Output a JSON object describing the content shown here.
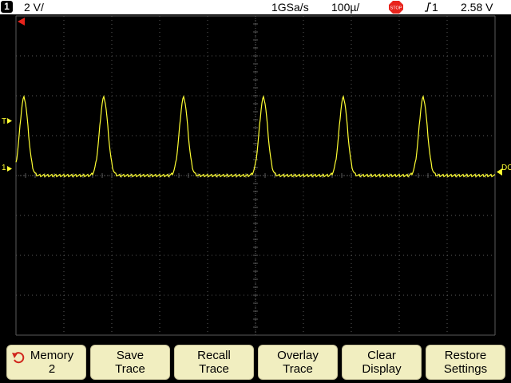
{
  "status_bar": {
    "channel_number": "1",
    "volts_per_div": "2 V/",
    "sample_rate": "1GSa/s",
    "time_per_div": "100µ/",
    "run_state_icon": "stop-icon",
    "run_state_label": "STOP",
    "trigger_slope_icon": "rising-edge-icon",
    "trigger_source": "1",
    "trigger_level": "2.58  V"
  },
  "markers": {
    "trigger_level_marker": "T",
    "channel_ground_marker": "1",
    "coupling_label": "DC"
  },
  "waveform": {
    "color": "#ffff33",
    "channel": "1",
    "peak_count": 6,
    "baseline_div_from_center": 0,
    "peak_div_from_center": 1.95
  },
  "softkeys": [
    {
      "line1": "Memory",
      "line2": "2",
      "icon": "undo-arrow-icon"
    },
    {
      "line1": "Save",
      "line2": "Trace"
    },
    {
      "line1": "Recall",
      "line2": "Trace"
    },
    {
      "line1": "Overlay",
      "line2": "Trace"
    },
    {
      "line1": "Clear",
      "line2": "Display"
    },
    {
      "line1": "Restore",
      "line2": "Settings"
    }
  ],
  "colors": {
    "trace": "#ffff33",
    "grid": "#5a5a5a",
    "softkey_bg": "#f1eec0",
    "stop_red": "#e8241c"
  }
}
